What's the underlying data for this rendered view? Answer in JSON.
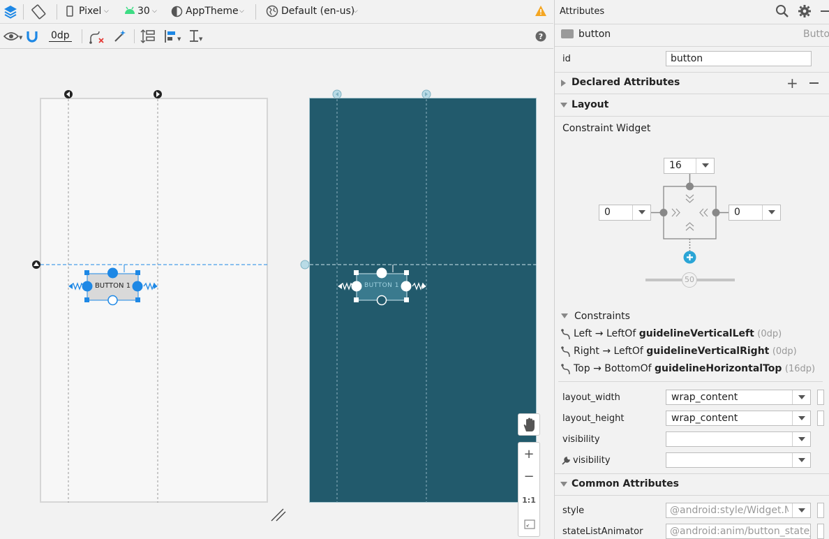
{
  "toolbar": {
    "device": "Pixel",
    "api_level": "30",
    "theme": "AppTheme",
    "locale": "Default (en-us)",
    "default_margin": "0dp"
  },
  "canvas": {
    "button_label": "BUTTON 1",
    "zoom_fit_label": "1:1"
  },
  "attributes": {
    "title": "Attributes",
    "component_name": "button",
    "component_type": "Button",
    "id_label": "id",
    "id_value": "button",
    "sections": {
      "declared": "Declared Attributes",
      "layout": "Layout",
      "common": "Common Attributes"
    },
    "constraint_widget_label": "Constraint Widget",
    "margin_top": "16",
    "margin_left": "0",
    "margin_right": "0",
    "bias_value": "50",
    "constraints_label": "Constraints",
    "constraints": [
      {
        "prefix": "Left → LeftOf ",
        "target": "guidelineVerticalLeft",
        "dp": "(0dp)"
      },
      {
        "prefix": "Right → LeftOf ",
        "target": "guidelineVerticalRight",
        "dp": "(0dp)"
      },
      {
        "prefix": "Top → BottomOf ",
        "target": "guidelineHorizontalTop",
        "dp": "(16dp)"
      }
    ],
    "layout_width_label": "layout_width",
    "layout_width_value": "wrap_content",
    "layout_height_label": "layout_height",
    "layout_height_value": "wrap_content",
    "visibility_label": "visibility",
    "tools_visibility_label": "visibility",
    "style_label": "style",
    "style_value": "@android:style/Widget.M",
    "state_list_animator_label": "stateListAnimator",
    "state_list_animator_value": "@android:anim/button_state_li"
  },
  "colors": {
    "accent": "#1e88e5",
    "design_surface": "#225a6c",
    "warning": "#f4a623"
  }
}
